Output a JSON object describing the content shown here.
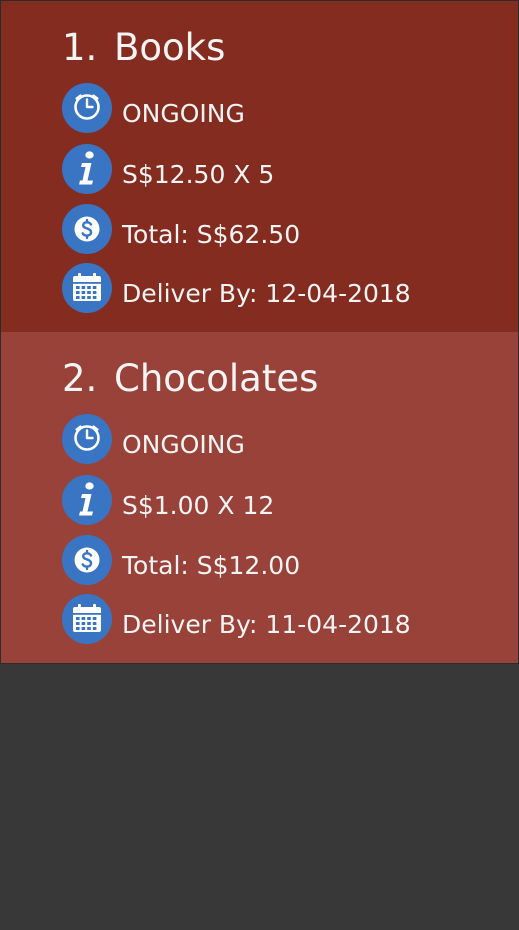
{
  "orders": [
    {
      "index": "1.",
      "name": "Books",
      "status": "ONGOING",
      "price_qty": "S$12.50 X 5",
      "total": "Total: S$62.50",
      "deliver_by": "Deliver By: 12-04-2018"
    },
    {
      "index": "2.",
      "name": "Chocolates",
      "status": "ONGOING",
      "price_qty": "S$1.00 X 12",
      "total": "Total: S$12.00",
      "deliver_by": "Deliver By: 11-04-2018"
    }
  ],
  "colors": {
    "card_1_bg": "#852c20",
    "card_2_bg": "#99423a",
    "empty_area_bg": "#383838",
    "icon_circle": "#3a75c4"
  },
  "icons": [
    "clock-icon",
    "info-icon",
    "dollar-icon",
    "calendar-icon"
  ]
}
